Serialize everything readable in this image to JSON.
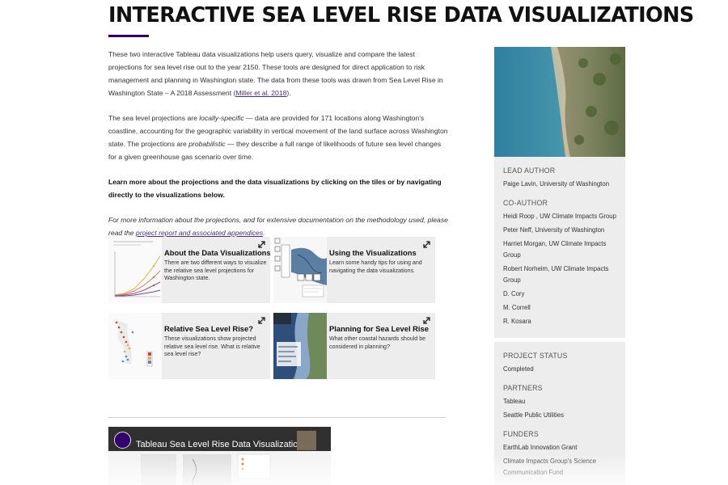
{
  "page": {
    "title": "INTERACTIVE SEA LEVEL RISE DATA VISUALIZATIONS",
    "accent_color": "#32006e",
    "link_color": "#4b2e83"
  },
  "intro": {
    "p1_text": "These two interactive Tableau data visualizations help users query, visualize and compare the latest projections for sea level rise out to the year 2150. These tools are designed for direct application to risk management and planning in Washington state. The data from these tools was drawn from Sea Level Rise in Washington State – A 2018 Assessment (",
    "p1_link": "Miller et al. 2018",
    "p1_end": ").",
    "p2_a": "The sea level projections are ",
    "p2_em1": "locally-specific",
    "p2_b": " — data are provided for 171 locations along Washington's coastline, accounting for the geographic variability in vertical movement of the land surface across Washington state. The projections are ",
    "p2_em2": "probabilistic",
    "p2_c": " — they describe a full range of likelihoods of future sea level changes for a given greenhouse gas scenario over time.",
    "p3_bold": "Learn more about the projections and the data visualizations by clicking on the tiles or by navigating directly to the visualizations below.",
    "p4_text": "For more information about the projections, and for extensive documentation on the methodology used, please read the ",
    "p4_link": "project report and associated appendices",
    "p4_end": "."
  },
  "tiles": [
    {
      "title": "About the Data Visualizations",
      "desc": "There are two different ways to visualize the relative sea level projections for Washington state.",
      "icon": "expand-icon"
    },
    {
      "title": "Using the Visualizations",
      "desc": "Learn some handy tips for using and navigating the data visualizations.",
      "icon": "expand-icon"
    },
    {
      "title": "Relative Sea Level Rise?",
      "desc": "These visualizations show projected relative sea level rise. What is relative sea level rise?",
      "icon": "expand-icon"
    },
    {
      "title": "Planning for Sea Level Rise",
      "desc": "What other coastal hazards should be considered in planning?",
      "icon": "expand-icon"
    }
  ],
  "video": {
    "title": "Tableau Sea Level Rise Data Visualization"
  },
  "sidebar": {
    "lead_author_heading": "LEAD AUTHOR",
    "lead_author": "Paige Lavin, University of Washington",
    "coauthor_heading": "CO-AUTHOR",
    "coauthors": [
      "Heidi Roop , UW Climate Impacts Group",
      "Peter Neff, University of Washington",
      "Harriet Morgan, UW Climate Impacts Group",
      "Robert Norheim, UW Climate Impacts Group",
      "D. Cory",
      "M. Correll",
      "R. Kosara"
    ],
    "status_heading": "PROJECT STATUS",
    "status": "Completed",
    "partners_heading": "PARTNERS",
    "partners": [
      "Tableau",
      "Seattle Public Utilities"
    ],
    "funders_heading": "FUNDERS",
    "funders": [
      "EarthLab Innovation Grant",
      "Climate Impacts Group's Science Communication Fund"
    ]
  }
}
